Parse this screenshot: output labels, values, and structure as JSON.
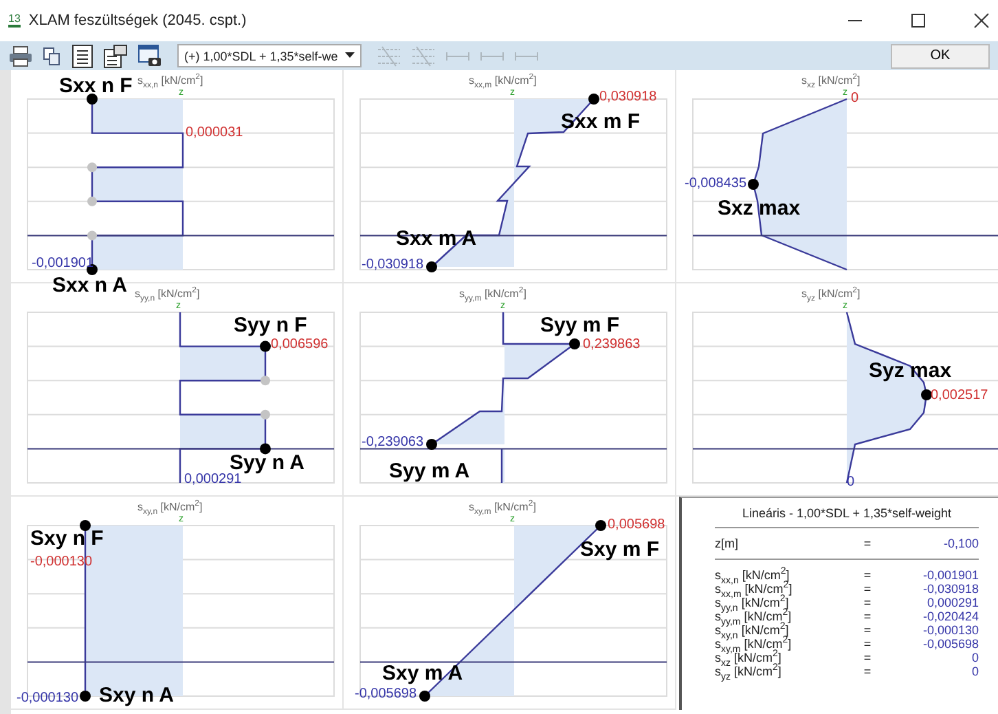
{
  "window": {
    "badge": "13",
    "title": "XLAM feszültségek (2045. cspt.)"
  },
  "toolbar": {
    "items": [
      {
        "kind": "print",
        "disabled": false
      },
      {
        "kind": "copy",
        "disabled": false
      },
      {
        "kind": "list",
        "disabled": false
      },
      {
        "kind": "clipboard",
        "disabled": false
      },
      {
        "kind": "camera",
        "disabled": false
      },
      {
        "kind": "combo",
        "value": "(+) 1,00*SDL + 1,35*self-we"
      },
      {
        "kind": "layers",
        "disabled": true
      },
      {
        "kind": "layers",
        "disabled": true
      },
      {
        "kind": "dimension",
        "disabled": true
      },
      {
        "kind": "dimension",
        "disabled": true
      },
      {
        "kind": "dimension",
        "disabled": true
      }
    ],
    "ok_button": "OK"
  },
  "diagrams": [
    {
      "heading": "s$_{xx,n}$ [kN/cm$^{2}$]",
      "axis": "z",
      "labels": [
        {
          "text": "Sxx n F",
          "kind": "name"
        },
        {
          "text": "0,000031",
          "kind": "max"
        },
        {
          "text": "-0,001901",
          "kind": "min"
        },
        {
          "text": "Sxx n A",
          "kind": "name"
        }
      ]
    },
    {
      "heading": "s$_{xx,m}$ [kN/cm$^{2}$]",
      "axis": "z",
      "labels": [
        {
          "text": "0,030918",
          "kind": "max"
        },
        {
          "text": "Sxx m F",
          "kind": "name"
        },
        {
          "text": "Sxx m A",
          "kind": "name"
        },
        {
          "text": "-0,030918",
          "kind": "min"
        }
      ]
    },
    {
      "heading": "s$_{xz}$ [kN/cm$^{2}$]",
      "axis": "z",
      "labels": [
        {
          "text": "0",
          "kind": "max"
        },
        {
          "text": "-0,008435",
          "kind": "min"
        },
        {
          "text": "Sxz max",
          "kind": "name"
        }
      ]
    },
    {
      "heading": "s$_{yy,n}$ [kN/cm$^{2}$]",
      "axis": "z",
      "labels": [
        {
          "text": "Syy n F",
          "kind": "name"
        },
        {
          "text": "0,006596",
          "kind": "max"
        },
        {
          "text": "Syy n A",
          "kind": "name"
        },
        {
          "text": "0,000291",
          "kind": "min"
        }
      ]
    },
    {
      "heading": "s$_{yy,m}$ [kN/cm$^{2}$]",
      "axis": "z",
      "labels": [
        {
          "text": "Syy m F",
          "kind": "name"
        },
        {
          "text": "0,239863",
          "kind": "max"
        },
        {
          "text": "-0,239063",
          "kind": "min"
        },
        {
          "text": "Syy m A",
          "kind": "name"
        }
      ]
    },
    {
      "heading": "s$_{yz}$ [kN/cm$^{2}$]",
      "axis": "z",
      "labels": [
        {
          "text": "Syz max",
          "kind": "name"
        },
        {
          "text": "0,002517",
          "kind": "max"
        },
        {
          "text": "0",
          "kind": "min"
        }
      ]
    },
    {
      "heading": "s$_{xy,n}$ [kN/cm$^{2}$]",
      "axis": "z",
      "labels": [
        {
          "text": "Sxy n F",
          "kind": "name"
        },
        {
          "text": "-0,000130",
          "kind": "max"
        },
        {
          "text": "-0,000130",
          "kind": "min"
        },
        {
          "text": "Sxy n A",
          "kind": "name"
        }
      ]
    },
    {
      "heading": "s$_{xy,m}$ [kN/cm$^{2}$]",
      "axis": "z",
      "labels": [
        {
          "text": "0,005698",
          "kind": "max"
        },
        {
          "text": "Sxy m F",
          "kind": "name"
        },
        {
          "text": "Sxy m A",
          "kind": "name"
        },
        {
          "text": "-0,005698",
          "kind": "min"
        }
      ]
    }
  ],
  "results": {
    "title": "Lineáris - 1,00*SDL + 1,35*self-weight",
    "z_row": {
      "label": "z[m]",
      "eq": "=",
      "value": "-0,100"
    },
    "rows": [
      {
        "label": "s$_{xx,n}$ [kN/cm$^{2}$]",
        "eq": "=",
        "value": "-0,001901"
      },
      {
        "label": "s$_{xx,m}$ [kN/cm$^{2}$]",
        "eq": "=",
        "value": "-0,030918"
      },
      {
        "label": "s$_{yy,n}$ [kN/cm$^{2}$]",
        "eq": "=",
        "value": "0,000291"
      },
      {
        "label": "s$_{yy,m}$ [kN/cm$^{2}$]",
        "eq": "=",
        "value": "-0,020424"
      },
      {
        "label": "s$_{xy,n}$ [kN/cm$^{2}$]",
        "eq": "=",
        "value": "-0,000130"
      },
      {
        "label": "s$_{xy,m}$ [kN/cm$^{2}$]",
        "eq": "=",
        "value": "-0,005698"
      },
      {
        "label": "s$_{xz}$ [kN/cm$^{2}$]",
        "eq": "=",
        "value": "0"
      },
      {
        "label": "s$_{yz}$ [kN/cm$^{2}$]",
        "eq": "=",
        "value": "0"
      }
    ]
  }
}
